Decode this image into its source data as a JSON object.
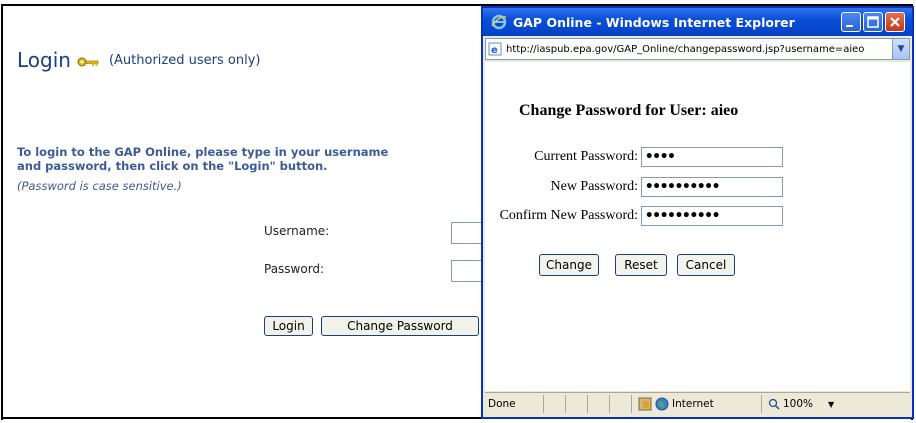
{
  "page": {
    "heading": "Login",
    "heading_note": "(Authorized users only)",
    "instructions_line1": "To login to the GAP Online, please type in your username",
    "instructions_line2": "and password, then click on the \"Login\" button.",
    "case_note": "(Password is case sensitive.)",
    "username_label": "Username:",
    "password_label": "Password:",
    "login_button": "Login",
    "change_password_button": "Change Password"
  },
  "ie_window": {
    "title": "GAP Online - Windows Internet Explorer",
    "url": "http://iaspub.epa.gov/GAP_Online/changepassword.jsp?username=aieo",
    "form_title": "Change Password for User: aieo",
    "current_password_label": "Current Password:",
    "current_password_value": "••••",
    "new_password_label": "New Password:",
    "new_password_value": "••••••••••",
    "confirm_password_label": "Confirm New Password:",
    "confirm_password_value": "••••••••••",
    "change_button": "Change",
    "reset_button": "Reset",
    "cancel_button": "Cancel",
    "status_text": "Done",
    "zone_text": "Internet",
    "zoom_text": "100%"
  },
  "icons": {
    "key": "key-icon",
    "ie_logo": "ie-logo-icon",
    "minimize": "minimize-icon",
    "maximize": "maximize-icon",
    "close": "close-icon",
    "globe": "globe-icon",
    "zoom": "zoom-icon",
    "shield": "protected-mode-icon"
  },
  "colors": {
    "heading": "#1a3f85",
    "instructions": "#3b5b9a",
    "titlebar": "#0a4fd7",
    "close_button": "#c3391a"
  }
}
